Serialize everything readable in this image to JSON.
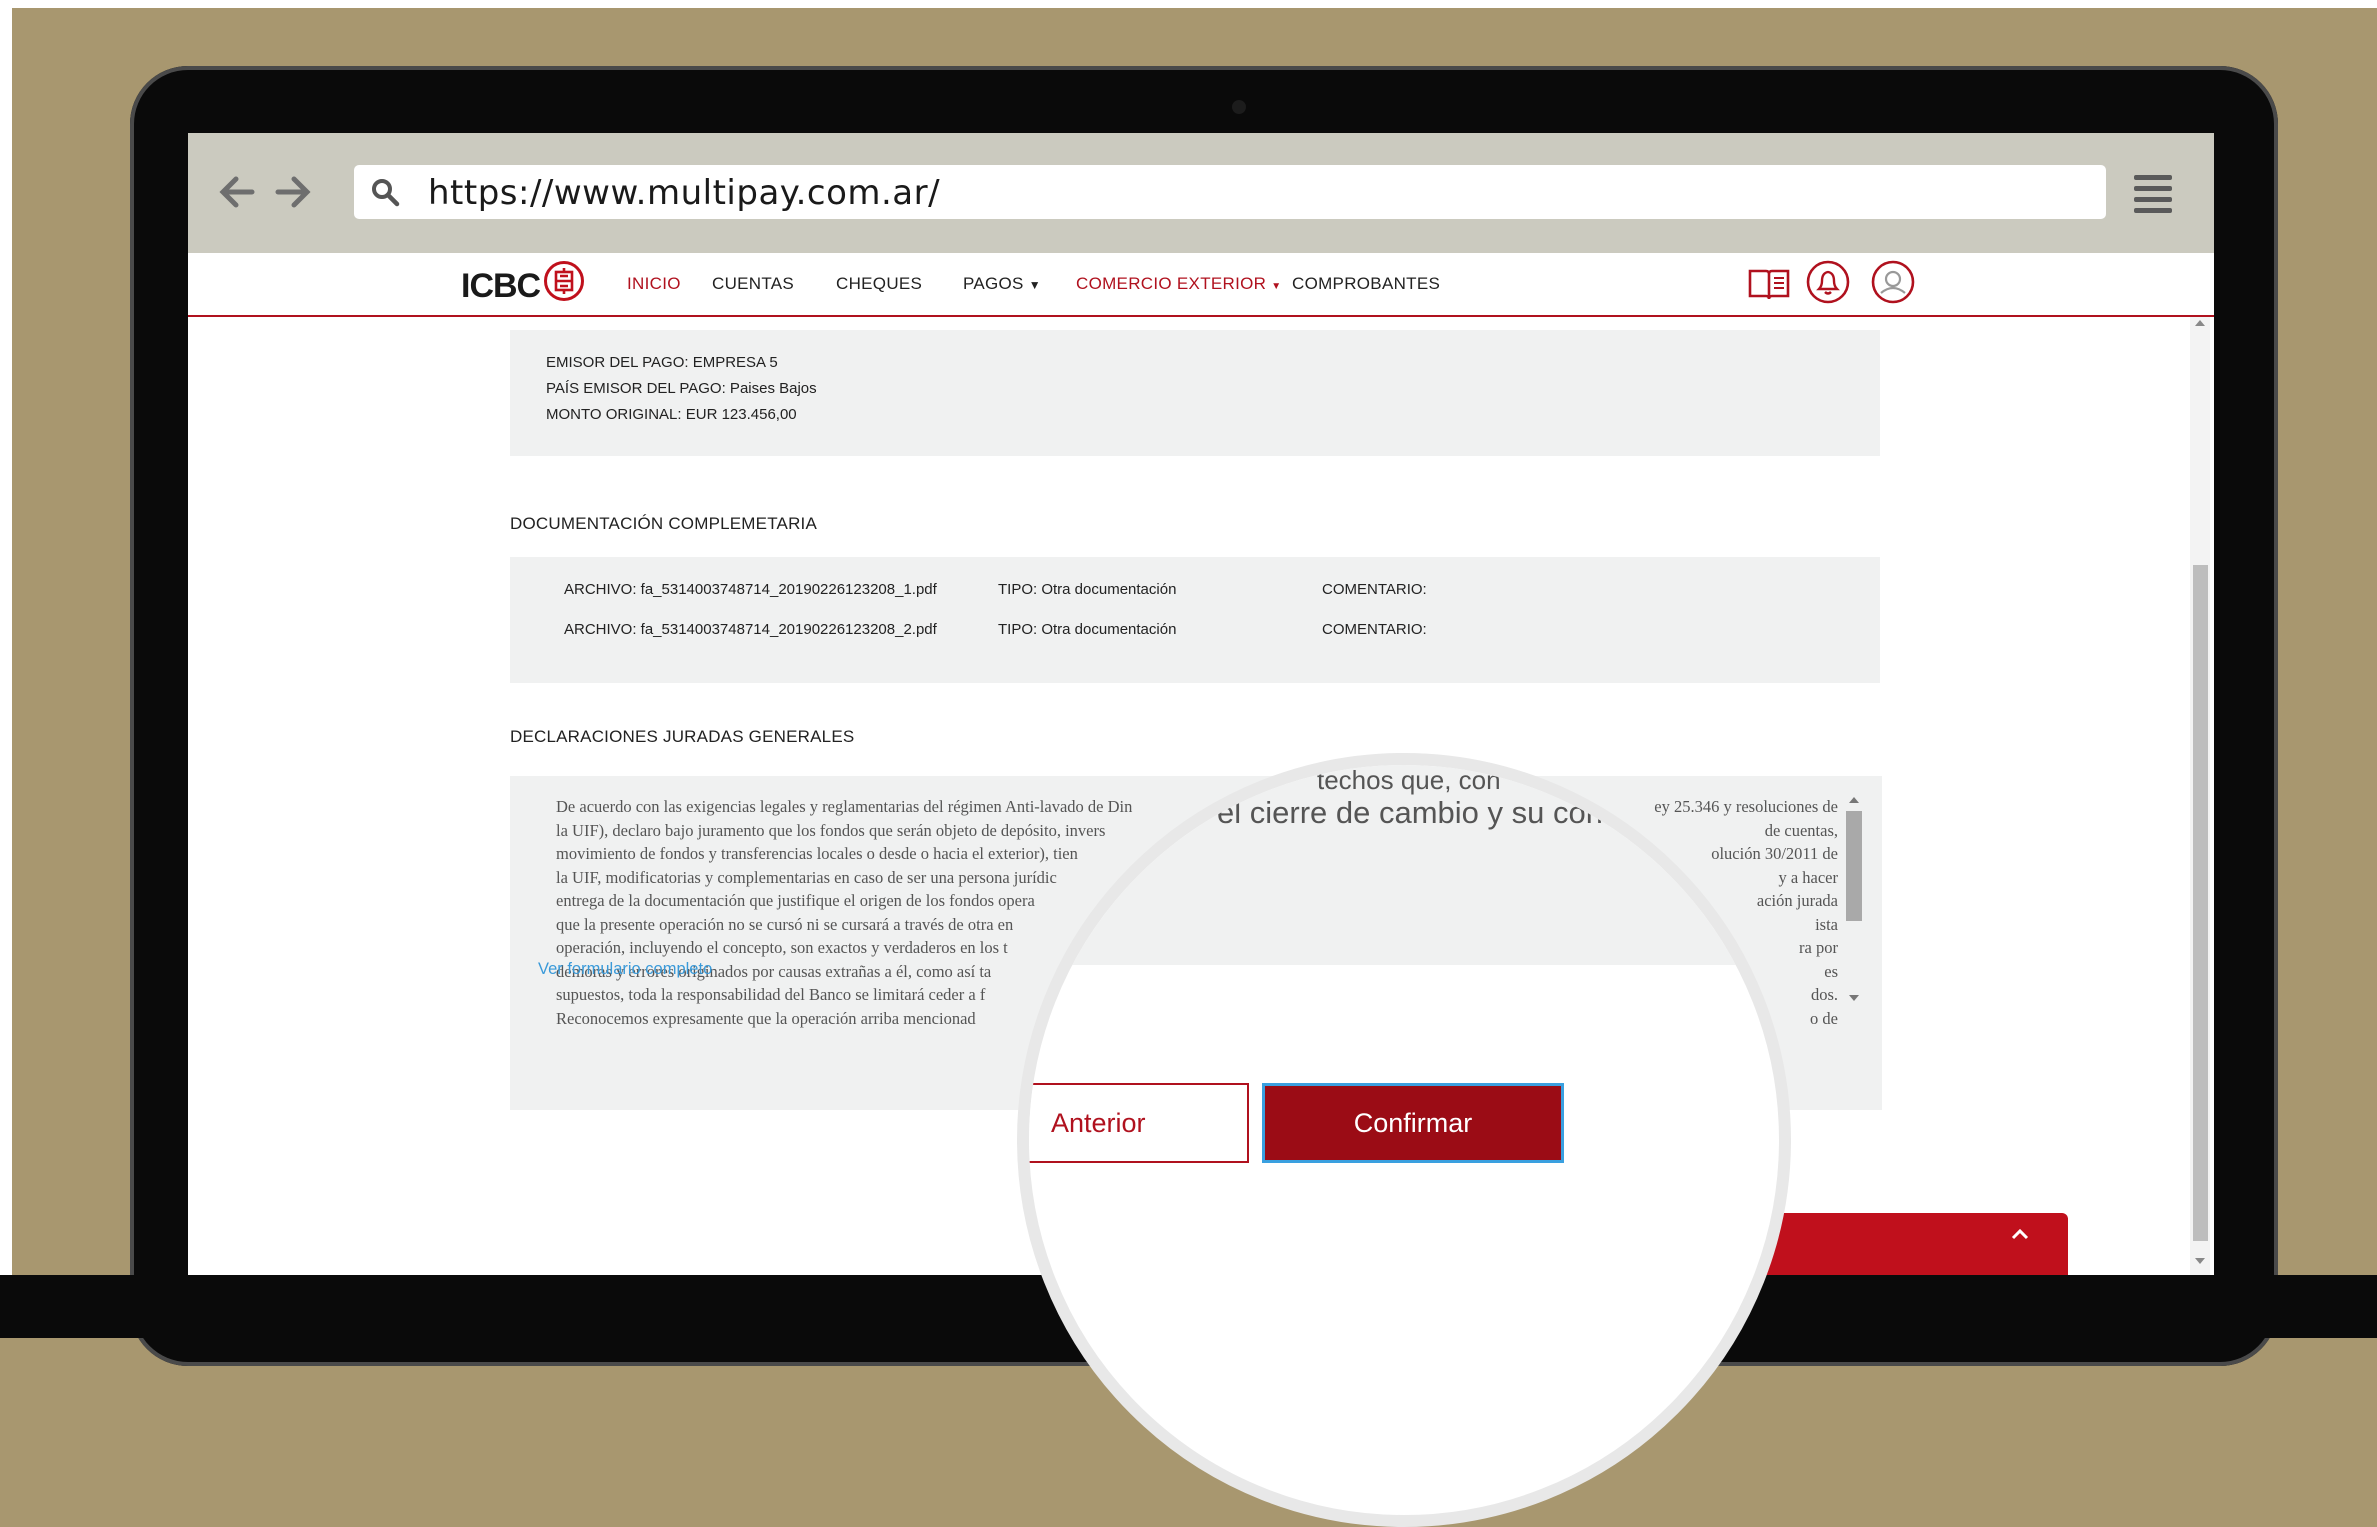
{
  "browser": {
    "url": "https://www.multipay.com.ar/"
  },
  "nav": {
    "logo": "ICBC",
    "items": [
      "INICIO",
      "CUENTAS",
      "CHEQUES",
      "PAGOS",
      "COMERCIO EXTERIOR",
      "COMPROBANTES"
    ],
    "active_color": "#b0111e"
  },
  "payment_info": {
    "emisor": "EMISOR DEL PAGO: EMPRESA 5",
    "pais": "PAÍS EMISOR DEL PAGO: Paises Bajos",
    "monto": "MONTO ORIGINAL: EUR 123.456,00"
  },
  "documentacion": {
    "title": "DOCUMENTACIÓN COMPLEMETARIA",
    "files": [
      {
        "archivo": "ARCHIVO: fa_5314003748714_20190226123208_1.pdf",
        "tipo": "TIPO: Otra documentación",
        "comentario": "COMENTARIO:"
      },
      {
        "archivo": "ARCHIVO: fa_5314003748714_20190226123208_2.pdf",
        "tipo": "TIPO: Otra documentación",
        "comentario": "COMENTARIO:"
      }
    ]
  },
  "declaraciones": {
    "title": "DECLARACIONES JURADAS GENERALES",
    "lines": [
      "De acuerdo con las exigencias legales y reglamentarias del régimen Anti-lavado de Din",
      "la UIF), declaro bajo juramento que los fondos que serán objeto de depósito, invers",
      "movimiento de fondos y transferencias locales o desde o hacia el exterior), tien",
      "la UIF, modificatorias y complementarias en caso de ser una persona jurídic",
      "entrega de la documentación que justifique el origen de los fondos opera",
      "que la presente operación no se cursó ni se cursará a través de otra en",
      "operación, incluyendo el concepto, son exactos y verdaderos en los t",
      "demoras y errores originados por causas extrañas a él, como así ta",
      "supuestos, toda la responsabilidad del Banco se limitará ceder a f",
      "Reconocemos expresamente que la operación arriba mencionad"
    ],
    "right_fragments": [
      "ey 25.346 y resoluciones de",
      "de cuentas,",
      "olución 30/2011 de",
      "y a hacer",
      "ación jurada",
      "ista",
      "ra por",
      "es",
      "dos.",
      "o de"
    ],
    "link": "Ver formulario completo"
  },
  "magnifier": {
    "text_top": "techos que, con",
    "text_mid": "el cierre de cambio y su corresp",
    "btn_anterior": "Anterior",
    "btn_confirmar": "Confirmar"
  }
}
